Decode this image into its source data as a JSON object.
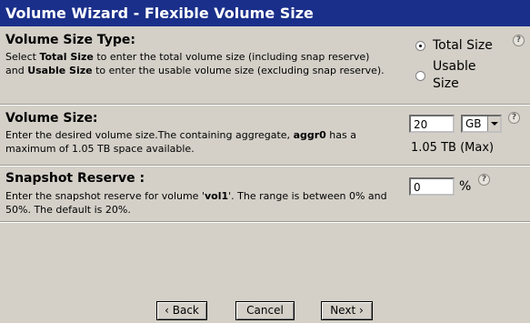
{
  "window": {
    "title": "Volume Wizard - Flexible Volume Size"
  },
  "size_type": {
    "heading": "Volume Size Type:",
    "desc_line1_a": "Select ",
    "desc_line1_b": "Total Size",
    "desc_line1_c": " to enter the total volume size (including snap reserve)",
    "desc_line2_a": "and ",
    "desc_line2_b": "Usable Size",
    "desc_line2_c": " to enter the usable volume size (excluding snap reserve).",
    "option_total": "Total Size",
    "option_usable_1": "Usable",
    "option_usable_2": "Size",
    "selected": "Total Size"
  },
  "volume_size": {
    "heading": "Volume Size:",
    "desc_line1_a": "Enter the desired volume size.The containing aggregate, ",
    "desc_line1_b": "aggr0",
    "desc_line1_c": " has a",
    "desc_line2": "maximum of 1.05 TB space available.",
    "value": "20",
    "unit": "GB",
    "max_text": "1.05 TB (Max)"
  },
  "snapshot": {
    "heading": "Snapshot Reserve :",
    "desc_line1_a": "Enter the snapshot reserve for volume '",
    "desc_line1_b": "vol1",
    "desc_line1_c": "'. The range is between 0% and",
    "desc_line2": "50%. The default is 20%.",
    "value": "0",
    "unit": "%"
  },
  "help_glyph": "?",
  "buttons": {
    "back": "‹ Back",
    "cancel": "Cancel",
    "next": "Next ›"
  }
}
